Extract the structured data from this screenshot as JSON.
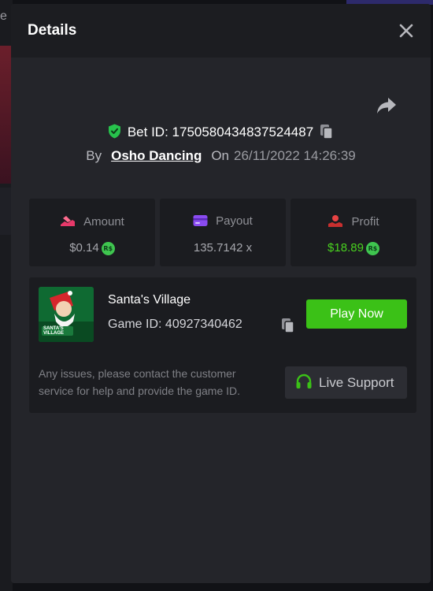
{
  "modal": {
    "title": "Details",
    "bet_id_label": "Bet ID:",
    "bet_id": "1750580434837524487",
    "by_label": "By",
    "username": "Osho Dancing",
    "on_label": "On",
    "datetime": "26/11/2022 14:26:39"
  },
  "stats": [
    {
      "label": "Amount",
      "value": "$0.14",
      "currency": "R$",
      "color": "#a6a7ad",
      "icon": "amount-icon"
    },
    {
      "label": "Payout",
      "value": "135.7142 x",
      "color": "#a6a7ad",
      "icon": "wallet-icon"
    },
    {
      "label": "Profit",
      "value": "$18.89",
      "currency": "R$",
      "color": "#49d11f",
      "icon": "profit-icon"
    }
  ],
  "game": {
    "name": "Santa's Village",
    "id_label": "Game ID:",
    "id": "40927340462",
    "thumb_text": "SANTA'S VILLAGE",
    "play_label": "Play Now",
    "issues_text": "Any issues, please contact the customer service for help and provide the game ID.",
    "support_label": "Live Support"
  },
  "background": {
    "edge_letter": "e"
  },
  "colors": {
    "accent_green": "#3bc117",
    "profit_green": "#49d11f",
    "amount_pink": "#e8396a",
    "payout_purple": "#8a4bf0",
    "profit_red": "#e84343"
  }
}
